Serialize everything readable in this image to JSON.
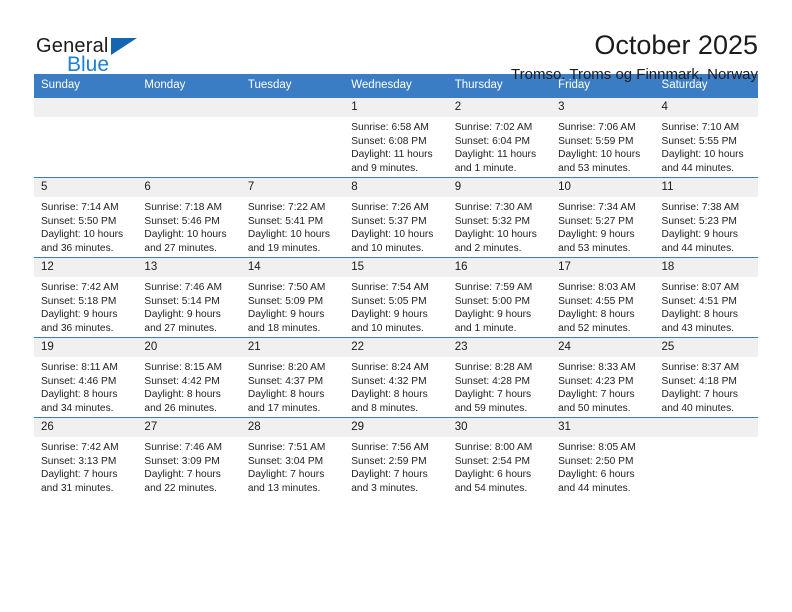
{
  "brand": {
    "name_top": "General",
    "name_bottom": "Blue",
    "triangle_color": "#1565b0",
    "blue_color": "#1f7fd0"
  },
  "header": {
    "title": "October 2025",
    "subtitle": "Tromso, Troms og Finnmark, Norway"
  },
  "theme": {
    "header_bg": "#3b7dc4",
    "daynum_bg": "#f0f0f0",
    "text": "#222222"
  },
  "weekdays": [
    "Sunday",
    "Monday",
    "Tuesday",
    "Wednesday",
    "Thursday",
    "Friday",
    "Saturday"
  ],
  "labels": {
    "sunrise": "Sunrise:",
    "sunset": "Sunset:",
    "daylight": "Daylight:"
  },
  "weeks": [
    [
      {
        "day": "",
        "sunrise": "",
        "sunset": "",
        "daylight1": "",
        "daylight2": ""
      },
      {
        "day": "",
        "sunrise": "",
        "sunset": "",
        "daylight1": "",
        "daylight2": ""
      },
      {
        "day": "",
        "sunrise": "",
        "sunset": "",
        "daylight1": "",
        "daylight2": ""
      },
      {
        "day": "1",
        "sunrise": "Sunrise: 6:58 AM",
        "sunset": "Sunset: 6:08 PM",
        "daylight1": "Daylight: 11 hours",
        "daylight2": "and 9 minutes."
      },
      {
        "day": "2",
        "sunrise": "Sunrise: 7:02 AM",
        "sunset": "Sunset: 6:04 PM",
        "daylight1": "Daylight: 11 hours",
        "daylight2": "and 1 minute."
      },
      {
        "day": "3",
        "sunrise": "Sunrise: 7:06 AM",
        "sunset": "Sunset: 5:59 PM",
        "daylight1": "Daylight: 10 hours",
        "daylight2": "and 53 minutes."
      },
      {
        "day": "4",
        "sunrise": "Sunrise: 7:10 AM",
        "sunset": "Sunset: 5:55 PM",
        "daylight1": "Daylight: 10 hours",
        "daylight2": "and 44 minutes."
      }
    ],
    [
      {
        "day": "5",
        "sunrise": "Sunrise: 7:14 AM",
        "sunset": "Sunset: 5:50 PM",
        "daylight1": "Daylight: 10 hours",
        "daylight2": "and 36 minutes."
      },
      {
        "day": "6",
        "sunrise": "Sunrise: 7:18 AM",
        "sunset": "Sunset: 5:46 PM",
        "daylight1": "Daylight: 10 hours",
        "daylight2": "and 27 minutes."
      },
      {
        "day": "7",
        "sunrise": "Sunrise: 7:22 AM",
        "sunset": "Sunset: 5:41 PM",
        "daylight1": "Daylight: 10 hours",
        "daylight2": "and 19 minutes."
      },
      {
        "day": "8",
        "sunrise": "Sunrise: 7:26 AM",
        "sunset": "Sunset: 5:37 PM",
        "daylight1": "Daylight: 10 hours",
        "daylight2": "and 10 minutes."
      },
      {
        "day": "9",
        "sunrise": "Sunrise: 7:30 AM",
        "sunset": "Sunset: 5:32 PM",
        "daylight1": "Daylight: 10 hours",
        "daylight2": "and 2 minutes."
      },
      {
        "day": "10",
        "sunrise": "Sunrise: 7:34 AM",
        "sunset": "Sunset: 5:27 PM",
        "daylight1": "Daylight: 9 hours",
        "daylight2": "and 53 minutes."
      },
      {
        "day": "11",
        "sunrise": "Sunrise: 7:38 AM",
        "sunset": "Sunset: 5:23 PM",
        "daylight1": "Daylight: 9 hours",
        "daylight2": "and 44 minutes."
      }
    ],
    [
      {
        "day": "12",
        "sunrise": "Sunrise: 7:42 AM",
        "sunset": "Sunset: 5:18 PM",
        "daylight1": "Daylight: 9 hours",
        "daylight2": "and 36 minutes."
      },
      {
        "day": "13",
        "sunrise": "Sunrise: 7:46 AM",
        "sunset": "Sunset: 5:14 PM",
        "daylight1": "Daylight: 9 hours",
        "daylight2": "and 27 minutes."
      },
      {
        "day": "14",
        "sunrise": "Sunrise: 7:50 AM",
        "sunset": "Sunset: 5:09 PM",
        "daylight1": "Daylight: 9 hours",
        "daylight2": "and 18 minutes."
      },
      {
        "day": "15",
        "sunrise": "Sunrise: 7:54 AM",
        "sunset": "Sunset: 5:05 PM",
        "daylight1": "Daylight: 9 hours",
        "daylight2": "and 10 minutes."
      },
      {
        "day": "16",
        "sunrise": "Sunrise: 7:59 AM",
        "sunset": "Sunset: 5:00 PM",
        "daylight1": "Daylight: 9 hours",
        "daylight2": "and 1 minute."
      },
      {
        "day": "17",
        "sunrise": "Sunrise: 8:03 AM",
        "sunset": "Sunset: 4:55 PM",
        "daylight1": "Daylight: 8 hours",
        "daylight2": "and 52 minutes."
      },
      {
        "day": "18",
        "sunrise": "Sunrise: 8:07 AM",
        "sunset": "Sunset: 4:51 PM",
        "daylight1": "Daylight: 8 hours",
        "daylight2": "and 43 minutes."
      }
    ],
    [
      {
        "day": "19",
        "sunrise": "Sunrise: 8:11 AM",
        "sunset": "Sunset: 4:46 PM",
        "daylight1": "Daylight: 8 hours",
        "daylight2": "and 34 minutes."
      },
      {
        "day": "20",
        "sunrise": "Sunrise: 8:15 AM",
        "sunset": "Sunset: 4:42 PM",
        "daylight1": "Daylight: 8 hours",
        "daylight2": "and 26 minutes."
      },
      {
        "day": "21",
        "sunrise": "Sunrise: 8:20 AM",
        "sunset": "Sunset: 4:37 PM",
        "daylight1": "Daylight: 8 hours",
        "daylight2": "and 17 minutes."
      },
      {
        "day": "22",
        "sunrise": "Sunrise: 8:24 AM",
        "sunset": "Sunset: 4:32 PM",
        "daylight1": "Daylight: 8 hours",
        "daylight2": "and 8 minutes."
      },
      {
        "day": "23",
        "sunrise": "Sunrise: 8:28 AM",
        "sunset": "Sunset: 4:28 PM",
        "daylight1": "Daylight: 7 hours",
        "daylight2": "and 59 minutes."
      },
      {
        "day": "24",
        "sunrise": "Sunrise: 8:33 AM",
        "sunset": "Sunset: 4:23 PM",
        "daylight1": "Daylight: 7 hours",
        "daylight2": "and 50 minutes."
      },
      {
        "day": "25",
        "sunrise": "Sunrise: 8:37 AM",
        "sunset": "Sunset: 4:18 PM",
        "daylight1": "Daylight: 7 hours",
        "daylight2": "and 40 minutes."
      }
    ],
    [
      {
        "day": "26",
        "sunrise": "Sunrise: 7:42 AM",
        "sunset": "Sunset: 3:13 PM",
        "daylight1": "Daylight: 7 hours",
        "daylight2": "and 31 minutes."
      },
      {
        "day": "27",
        "sunrise": "Sunrise: 7:46 AM",
        "sunset": "Sunset: 3:09 PM",
        "daylight1": "Daylight: 7 hours",
        "daylight2": "and 22 minutes."
      },
      {
        "day": "28",
        "sunrise": "Sunrise: 7:51 AM",
        "sunset": "Sunset: 3:04 PM",
        "daylight1": "Daylight: 7 hours",
        "daylight2": "and 13 minutes."
      },
      {
        "day": "29",
        "sunrise": "Sunrise: 7:56 AM",
        "sunset": "Sunset: 2:59 PM",
        "daylight1": "Daylight: 7 hours",
        "daylight2": "and 3 minutes."
      },
      {
        "day": "30",
        "sunrise": "Sunrise: 8:00 AM",
        "sunset": "Sunset: 2:54 PM",
        "daylight1": "Daylight: 6 hours",
        "daylight2": "and 54 minutes."
      },
      {
        "day": "31",
        "sunrise": "Sunrise: 8:05 AM",
        "sunset": "Sunset: 2:50 PM",
        "daylight1": "Daylight: 6 hours",
        "daylight2": "and 44 minutes."
      },
      {
        "day": "",
        "sunrise": "",
        "sunset": "",
        "daylight1": "",
        "daylight2": ""
      }
    ]
  ]
}
